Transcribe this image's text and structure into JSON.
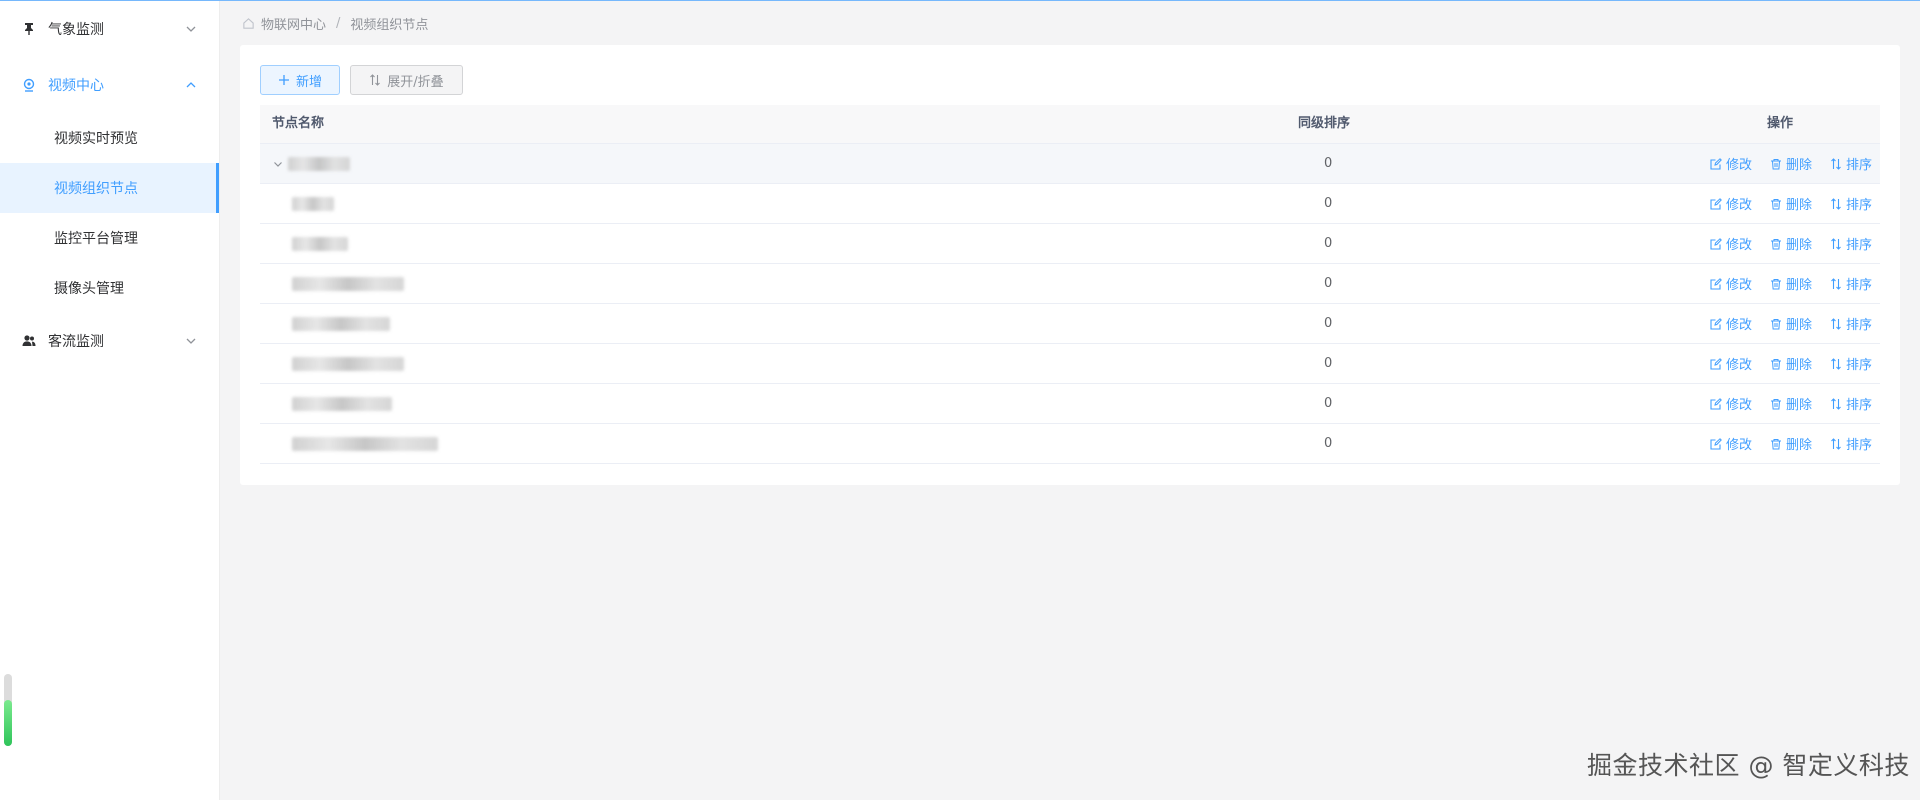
{
  "sidebar": {
    "menu": [
      {
        "label": "气象监测",
        "icon": "pushpin-icon",
        "open": false
      },
      {
        "label": "视频中心",
        "icon": "camera-icon",
        "open": true
      },
      {
        "label": "客流监测",
        "icon": "users-icon",
        "open": false
      }
    ],
    "video_submenu": [
      "视频实时预览",
      "视频组织节点",
      "监控平台管理",
      "摄像头管理"
    ],
    "active_submenu": "视频组织节点"
  },
  "breadcrumb": {
    "home": "物联网中心",
    "separator": "/",
    "current": "视频组织节点"
  },
  "toolbar": {
    "add_label": "新增",
    "toggle_label": "展开/折叠"
  },
  "table": {
    "columns": {
      "name": "节点名称",
      "order": "同级排序",
      "ops": "操作"
    },
    "rows": [
      {
        "name": "",
        "order": "0"
      },
      {
        "name": "",
        "order": "0"
      },
      {
        "name": "",
        "order": "0"
      },
      {
        "name": "",
        "order": "0"
      },
      {
        "name": "",
        "order": "0"
      },
      {
        "name": "",
        "order": "0"
      },
      {
        "name": "",
        "order": "0"
      },
      {
        "name": "",
        "order": "0"
      }
    ],
    "actions": {
      "edit": "修改",
      "delete": "删除",
      "sort": "排序"
    }
  },
  "watermark": "掘金技术社区 @ 智定义科技",
  "colors": {
    "accent": "#409eff",
    "active_bg": "#e8f3ff",
    "page_bg": "#f4f4f5"
  }
}
